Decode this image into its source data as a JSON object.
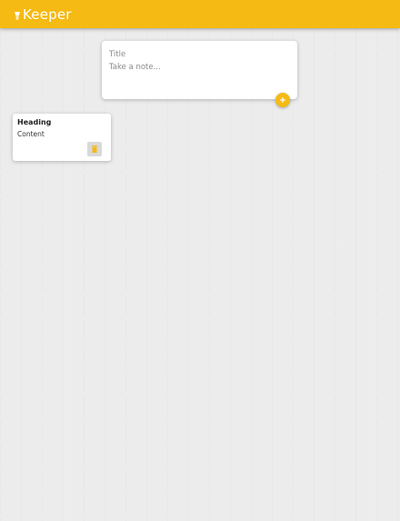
{
  "header": {
    "brand_title": "Keeper",
    "brand_icon": "lightbulb-icon",
    "background_color": "#f5ba13"
  },
  "create_note": {
    "title_placeholder": "Title",
    "content_placeholder": "Take a note...",
    "add_icon": "plus-icon"
  },
  "notes": [
    {
      "title": "Heading",
      "content": "Content",
      "delete_icon": "trash-icon"
    }
  ],
  "colors": {
    "accent": "#f5ba13",
    "background": "#ececec",
    "card": "#ffffff"
  }
}
